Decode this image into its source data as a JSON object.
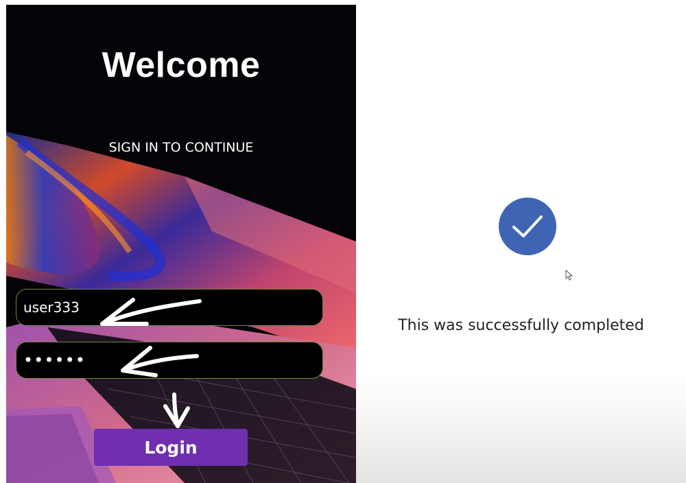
{
  "login": {
    "title": "Welcome",
    "subtitle": "SIGN IN TO CONTINUE",
    "username_value": "user333",
    "password_value": "••••••",
    "login_button": "Login"
  },
  "success": {
    "icon": "checkmark-icon",
    "message": "This was successfully completed"
  },
  "colors": {
    "login_button": "#6f2fb0",
    "check_circle": "#3f64b4",
    "field_border": "#6d8a3a"
  }
}
